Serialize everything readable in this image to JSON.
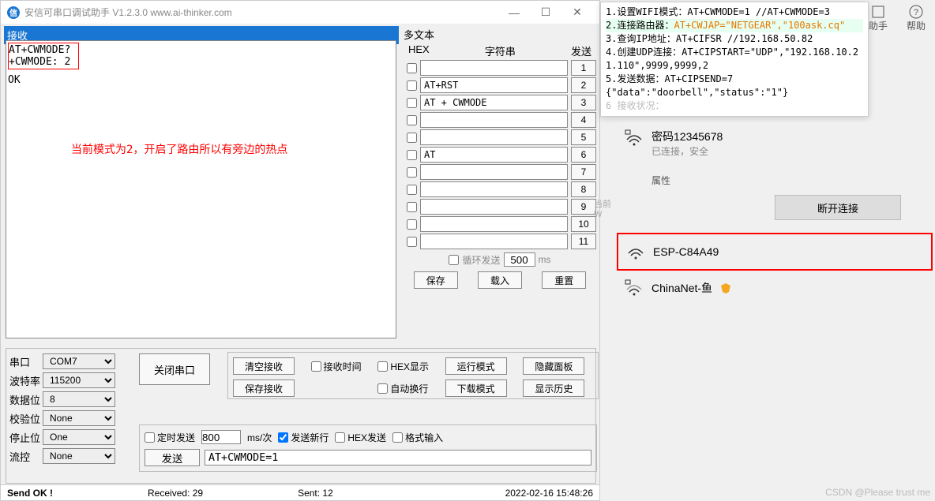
{
  "window": {
    "title": "安信可串口调试助手 V1.2.3.0    www.ai-thinker.com",
    "logo_text": "信"
  },
  "recv": {
    "label": "接收",
    "line1": "AT+CWMODE?",
    "line2": "+CWMODE: 2",
    "line3": "OK",
    "red_note": "当前模式为2，开启了路由所以有旁边的热点"
  },
  "multi": {
    "title": "多文本",
    "head_hex": "HEX",
    "head_str": "字符串",
    "head_send": "发送",
    "rows": [
      {
        "text": "",
        "btn": "1"
      },
      {
        "text": "AT+RST",
        "btn": "2"
      },
      {
        "text": "AT + CWMODE",
        "btn": "3"
      },
      {
        "text": "",
        "btn": "4"
      },
      {
        "text": "",
        "btn": "5"
      },
      {
        "text": "AT",
        "btn": "6"
      },
      {
        "text": "",
        "btn": "7"
      },
      {
        "text": "",
        "btn": "8"
      },
      {
        "text": "",
        "btn": "9"
      },
      {
        "text": "",
        "btn": "10"
      },
      {
        "text": "",
        "btn": "11"
      }
    ],
    "loop_label": "循环发送",
    "loop_value": "500",
    "loop_unit": "ms",
    "btn_save": "保存",
    "btn_load": "载入",
    "btn_reset": "重置"
  },
  "serial": {
    "settings": [
      {
        "label": "串口",
        "value": "COM7"
      },
      {
        "label": "波特率",
        "value": "115200"
      },
      {
        "label": "数据位",
        "value": "8"
      },
      {
        "label": "校验位",
        "value": "None"
      },
      {
        "label": "停止位",
        "value": "One"
      },
      {
        "label": "流控",
        "value": "None"
      }
    ],
    "btn_close_port": "关闭串口",
    "btn_clear_recv": "清空接收",
    "chk_recv_time": "接收时间",
    "chk_hex_display": "HEX显示",
    "btn_run_mode": "运行模式",
    "btn_hide_panel": "隐藏面板",
    "btn_save_recv": "保存接收",
    "chk_auto_wrap": "自动换行",
    "btn_download_mode": "下载模式",
    "btn_show_history": "显示历史",
    "chk_timed_send": "定时发送",
    "timed_value": "800",
    "timed_unit": "ms/次",
    "chk_send_newline": "发送新行",
    "chk_hex_send": "HEX发送",
    "chk_fmt_input": "格式输入",
    "btn_send": "发送",
    "cmd_input": "AT+CWMODE=1"
  },
  "status": {
    "send_ok": "Send OK !",
    "received": "Received: 29",
    "sent": "Sent: 12",
    "timestamp": "2022-02-16 15:48:26"
  },
  "code": {
    "lines": [
      {
        "n": "1.",
        "t": "设置WIFI模式：AT+CWMODE=1    //AT+CWMODE=3"
      },
      {
        "n": "2.",
        "t": "连接路由器：",
        "hl": "AT+CWJAP=\"NETGEAR\",\"100ask.cq\""
      },
      {
        "n": "3.",
        "t": "查询IP地址：AT+CIFSR  //192.168.50.82"
      },
      {
        "n": "4.",
        "t": "创建UDP连接：AT+CIPSTART=\"UDP\",\"192.168.10.2"
      },
      {
        "n": "1.",
        "t": "110\",9999,9999,2"
      },
      {
        "n": "5.",
        "t": "发送数据：AT+CIPSEND=7"
      },
      {
        "n": "",
        "t": "{\"data\":\"doorbell\",\"status\":\"1\"}"
      },
      {
        "n": "6",
        "t": "接收状况："
      }
    ]
  },
  "right_icons": {
    "hand": "助手",
    "help": "帮助"
  },
  "wifi": {
    "connected_name": "密码12345678",
    "connected_status": "已连接，安全",
    "properties": "属性",
    "disconnect": "断开连接",
    "net1": "ESP-C84A49",
    "net2": "ChinaNet-鱼"
  },
  "stub": "当前 W",
  "watermark": "CSDN @Please trust me"
}
